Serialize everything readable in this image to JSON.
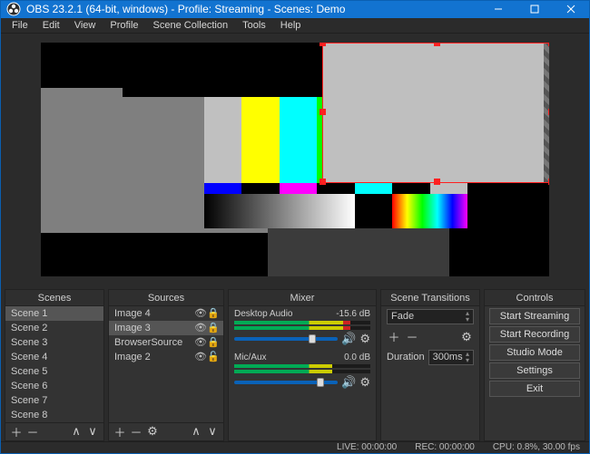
{
  "title": "OBS 23.2.1 (64-bit, windows) - Profile: Streaming - Scenes: Demo",
  "menu": {
    "file": "File",
    "edit": "Edit",
    "view": "View",
    "profile": "Profile",
    "scene_collection": "Scene Collection",
    "tools": "Tools",
    "help": "Help"
  },
  "panels": {
    "scenes": "Scenes",
    "sources": "Sources",
    "mixer": "Mixer",
    "transitions": "Scene Transitions",
    "controls": "Controls"
  },
  "scenes": [
    "Scene 1",
    "Scene 2",
    "Scene 3",
    "Scene 4",
    "Scene 5",
    "Scene 6",
    "Scene 7",
    "Scene 8"
  ],
  "scene_selected": 0,
  "sources": [
    {
      "name": "Image 4",
      "visible": true,
      "locked": true
    },
    {
      "name": "Image 3",
      "visible": true,
      "locked": true,
      "selected": true
    },
    {
      "name": "BrowserSource",
      "visible": true,
      "locked": true
    },
    {
      "name": "Image 2",
      "visible": true,
      "locked": false
    }
  ],
  "mixer": [
    {
      "name": "Desktop Audio",
      "db": "-15.6 dB",
      "slider": 0.72
    },
    {
      "name": "Mic/Aux",
      "db": "0.0 dB",
      "slider": 0.8
    }
  ],
  "transitions": {
    "current": "Fade",
    "duration_label": "Duration",
    "duration": "300ms"
  },
  "controls": {
    "start_stream": "Start Streaming",
    "start_rec": "Start Recording",
    "studio": "Studio Mode",
    "settings": "Settings",
    "exit": "Exit"
  },
  "status": {
    "live": "LIVE: 00:00:00",
    "rec": "REC: 00:00:00",
    "cpu": "CPU: 0.8%, 30.00 fps"
  }
}
